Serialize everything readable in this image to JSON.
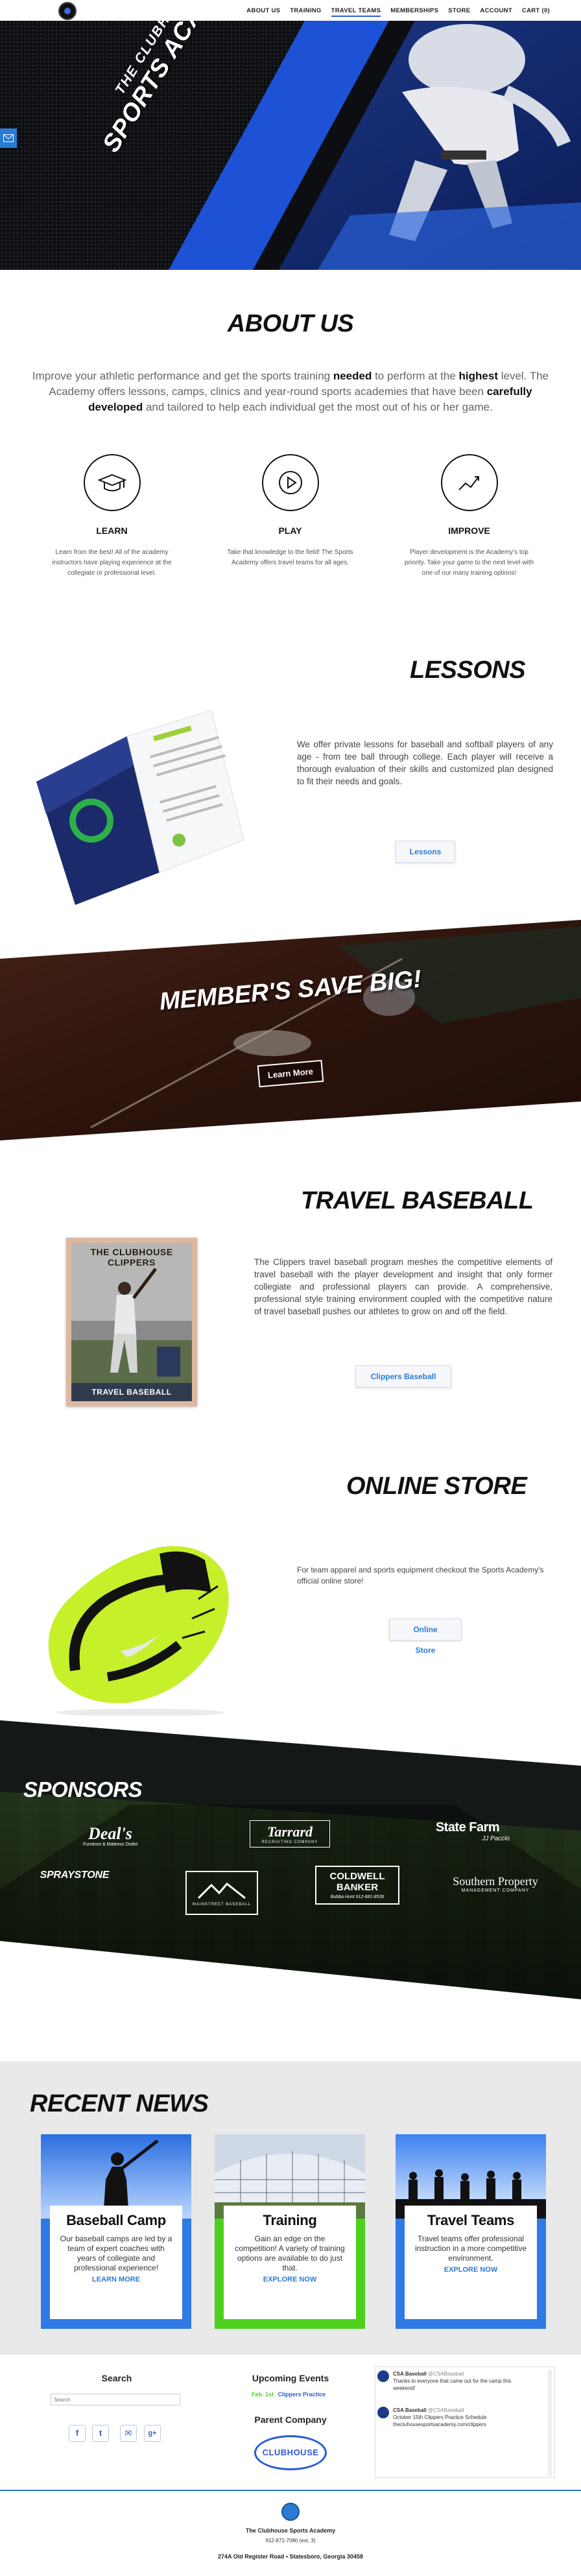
{
  "nav": {
    "items": [
      "ABOUT US",
      "TRAINING",
      "TRAVEL TEAMS",
      "MEMBERSHIPS",
      "STORE",
      "ACCOUNT",
      "CART (0)"
    ],
    "active_index": 2
  },
  "hero": {
    "line1": "THE CLUBHOUSE",
    "line2": "SPORTS ACADEMY"
  },
  "about": {
    "title": "ABOUT US",
    "text_parts": [
      "Improve your athletic performance and get the sports training ",
      "needed",
      " to perform at the ",
      "highest",
      " level. The Academy offers lessons, camps, clinics and year-round sports academies that have been ",
      "carefully developed",
      " and tailored to help each individual get the most out of his or her game."
    ],
    "features": [
      {
        "icon": "graduation-cap-icon",
        "label": "LEARN",
        "desc": "Learn from the best! All of the academy instructors have playing experience at the collegiate or professional level."
      },
      {
        "icon": "play-icon",
        "label": "PLAY",
        "desc": "Take that knowledge to the field! The Sports Academy offers travel teams for all ages."
      },
      {
        "icon": "chart-line-icon",
        "label": "IMPROVE",
        "desc": "Player development is the Academy's top priority. Take your game to the next level with one of our many training options!"
      }
    ]
  },
  "lessons": {
    "title": "LESSONS",
    "text": "We offer private lessons for baseball and softball players of any age - from tee ball through college. Each player will receive a thorough evaluation of their skills and customized plan designed to fit their needs and goals.",
    "button": "Lessons"
  },
  "member": {
    "title": "MEMBER'S SAVE BIG!",
    "button": "Learn More"
  },
  "travel": {
    "title": "TRAVEL BASEBALL",
    "text": "The Clippers travel baseball program meshes the competitive elements of travel baseball with the player development and insight that only former collegiate and professional players can provide. A comprehensive, professional style training environment coupled with the competitive nature of travel baseball pushes our athletes to grow on and off the field.",
    "button": "Clippers Baseball",
    "card_title": "THE CLUBHOUSE CLIPPERS",
    "card_footer": "TRAVEL BASEBALL"
  },
  "store": {
    "title": "ONLINE STORE",
    "text": "For team apparel and sports equipment checkout the Sports Academy's official online store!",
    "button": "Online Store"
  },
  "sponsors": {
    "title": "SPONSORS",
    "logos": [
      {
        "name": "Deal's",
        "sub": "Furniture & Mattress Outlet"
      },
      {
        "name": "Tarrard",
        "sub": "Recruiting Company"
      },
      {
        "name": "State Farm",
        "sub": "JJ Paccio"
      },
      {
        "name": "SPRAYSTONE",
        "sub": ""
      },
      {
        "name": "MAINSTREET BASEBALL",
        "sub": ""
      },
      {
        "name": "COLDWELL BANKER",
        "sub": "Bubba Hunt 912-681-8536"
      },
      {
        "name": "Southern Property",
        "sub": "Management Company"
      }
    ]
  },
  "news": {
    "title": "RECENT NEWS",
    "cards": [
      {
        "title": "Baseball Camp",
        "desc": "Our baseball camps are led by a team of expert coaches with years of collegiate and professional experience!",
        "link": "LEARN MORE",
        "color": "#2f7ae5"
      },
      {
        "title": "Training",
        "desc": "Gain an edge on the competition! A variety of training options are available to do just that.",
        "link": "EXPLORE NOW",
        "color": "#4ed11d"
      },
      {
        "title": "Travel Teams",
        "desc": "Travel teams offer professional instruction in a more competitive environment.",
        "link": "EXPLORE NOW",
        "color": "#2f7ae5"
      }
    ]
  },
  "footer": {
    "search_title": "Search",
    "search_placeholder": "Search",
    "events_title": "Upcoming Events",
    "event_date": "Feb. 1st",
    "event_name": "Clippers Practice",
    "parent_title": "Parent Company",
    "parent_logo": "CLUBHOUSE",
    "social": [
      "f",
      "t",
      "✉",
      "g+"
    ],
    "tweets": [
      {
        "user": "CSA Baseball",
        "handle": "@CSABaseball",
        "text": "Thanks to everyone that came out for the camp this weekend!"
      },
      {
        "user": "CSA Baseball",
        "handle": "@CSABaseball",
        "text": "October 15th Clippers Practice Schedule thecluhousesportsacademy.com/clippers"
      }
    ],
    "company": "The Clubhouse Sports Academy",
    "phone": "912-871-7080 (ext. 3)",
    "address": "274A Old Register Road • Statesboro, Georgia 30458"
  }
}
